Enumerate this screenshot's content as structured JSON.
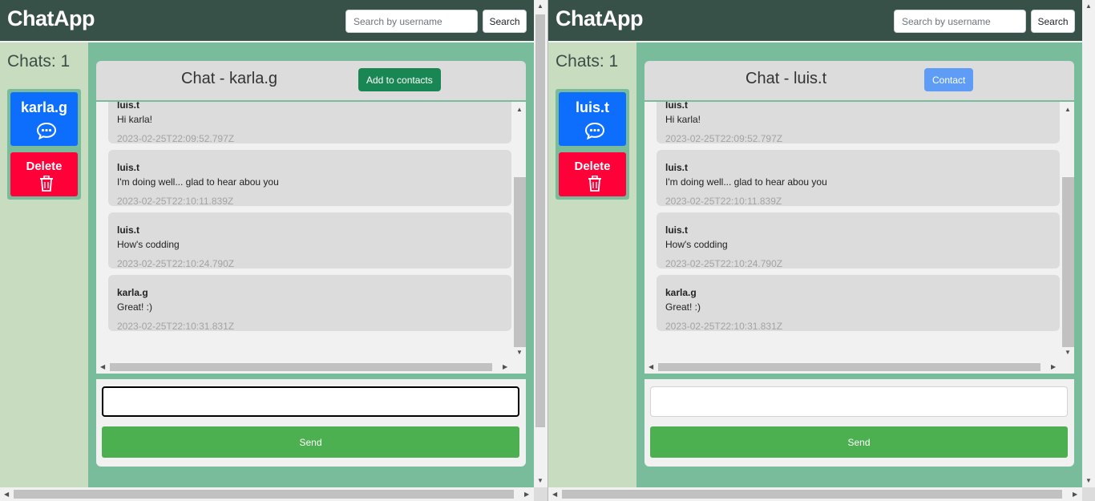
{
  "panes": [
    {
      "brand": "ChatApp",
      "search": {
        "placeholder": "Search by username",
        "button": "Search"
      },
      "sidebar": {
        "chats_count": "Chats: 1",
        "contact": {
          "name": "karla.g",
          "icon": "chat-bubble-icon"
        },
        "delete": {
          "label": "Delete",
          "icon": "trash-icon"
        }
      },
      "chat": {
        "title": "Chat - karla.g",
        "action_button": "Add to contacts",
        "action_color": "#198754",
        "input_value": "",
        "send_label": "Send"
      }
    },
    {
      "brand": "ChatApp",
      "search": {
        "placeholder": "Search by username",
        "button": "Search"
      },
      "sidebar": {
        "chats_count": "Chats: 1",
        "contact": {
          "name": "luis.t",
          "icon": "chat-bubble-icon"
        },
        "delete": {
          "label": "Delete",
          "icon": "trash-icon"
        }
      },
      "chat": {
        "title": "Chat - luis.t",
        "action_button": "Contact",
        "action_color": "#5e9cf5",
        "input_value": "",
        "send_label": "Send"
      }
    }
  ],
  "messages": [
    {
      "author": "luis.t",
      "text": "Hi karla!",
      "time": "2023-02-25T22:09:52.797Z"
    },
    {
      "author": "luis.t",
      "text": "I'm doing well... glad to hear abou you",
      "time": "2023-02-25T22:10:11.839Z"
    },
    {
      "author": "luis.t",
      "text": "How's codding",
      "time": "2023-02-25T22:10:24.790Z"
    },
    {
      "author": "karla.g",
      "text": "Great! :)",
      "time": "2023-02-25T22:10:31.831Z"
    }
  ],
  "colors": {
    "navbar": "#385148",
    "sidebar": "#c8dcbf",
    "main": "#79bc9b",
    "contact_card": "#0d6efd",
    "delete_card": "#ff0038",
    "send": "#4caf50"
  }
}
